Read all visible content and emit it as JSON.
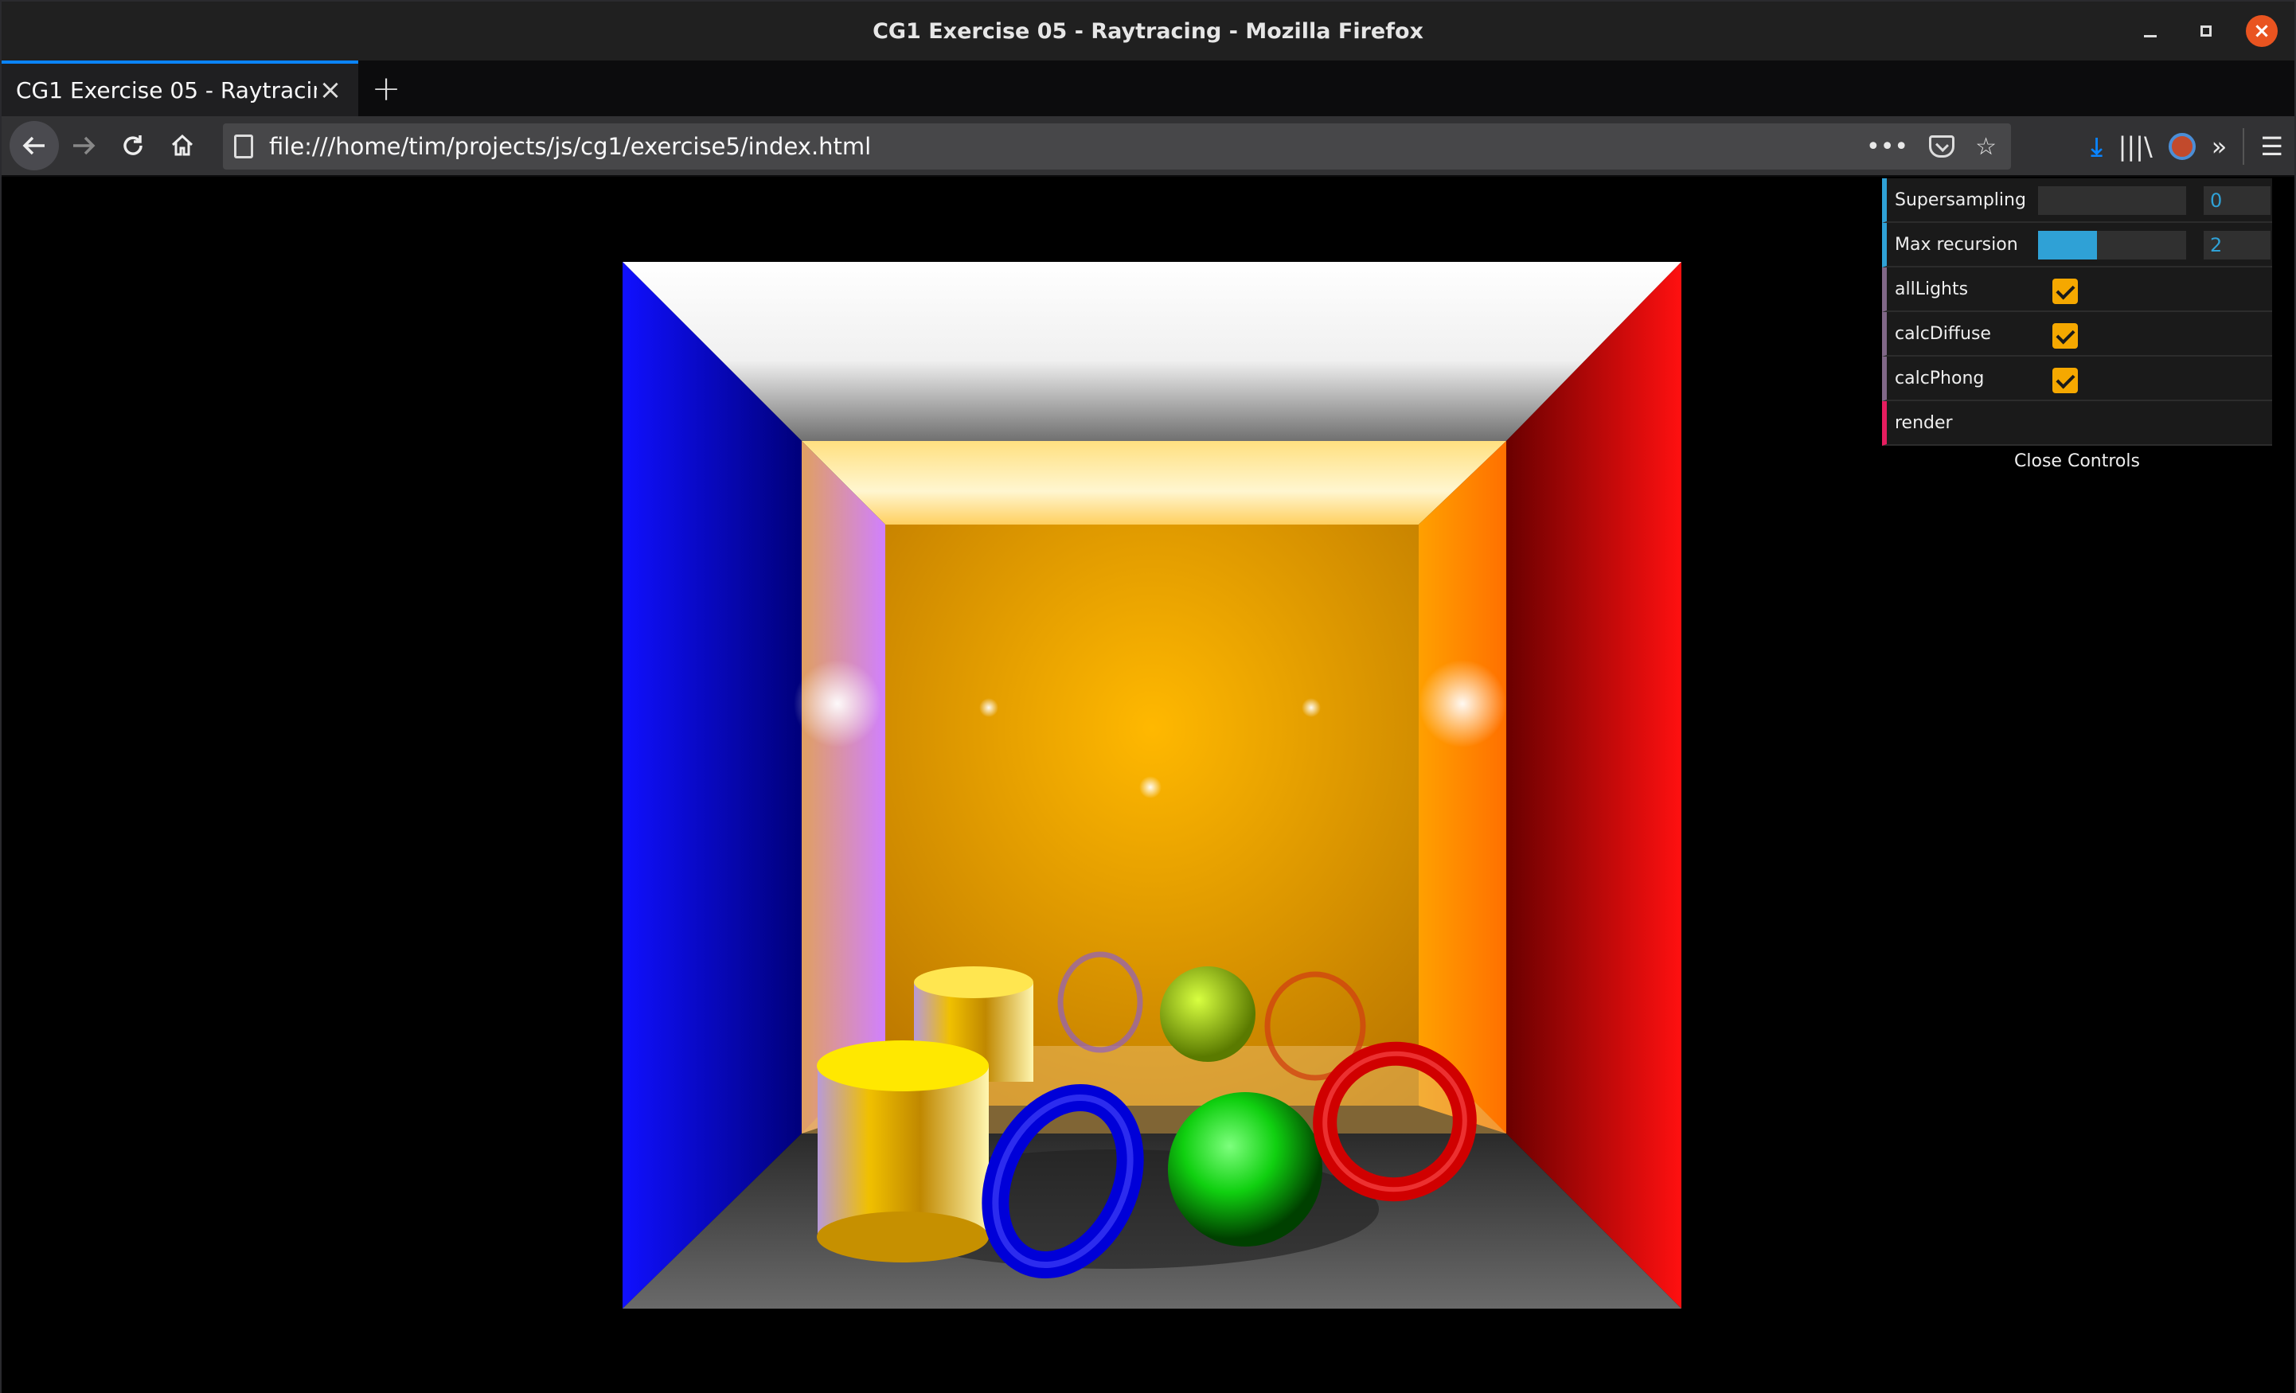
{
  "window": {
    "title": "CG1 Exercise 05 - Raytracing - Mozilla Firefox"
  },
  "tabs": [
    {
      "title": "CG1 Exercise 05 - Raytracing",
      "active": true
    }
  ],
  "navbar": {
    "url": "file:///home/tim/projects/js/cg1/exercise5/index.html"
  },
  "gui": {
    "controls": [
      {
        "label": "Supersampling",
        "type": "slider",
        "value": "0",
        "fill": 0.0
      },
      {
        "label": "Max recursion",
        "type": "slider",
        "value": "2",
        "fill": 0.4
      },
      {
        "label": "allLights",
        "type": "checkbox",
        "checked": true
      },
      {
        "label": "calcDiffuse",
        "type": "checkbox",
        "checked": true
      },
      {
        "label": "calcPhong",
        "type": "checkbox",
        "checked": true
      },
      {
        "label": "render",
        "type": "button"
      }
    ],
    "close_label": "Close Controls"
  },
  "colors": {
    "accent": "#0a84ff",
    "gui_number": "#2fa1d6",
    "gui_checkbox": "#f5a800",
    "gui_button_marker": "#e61d5f"
  }
}
